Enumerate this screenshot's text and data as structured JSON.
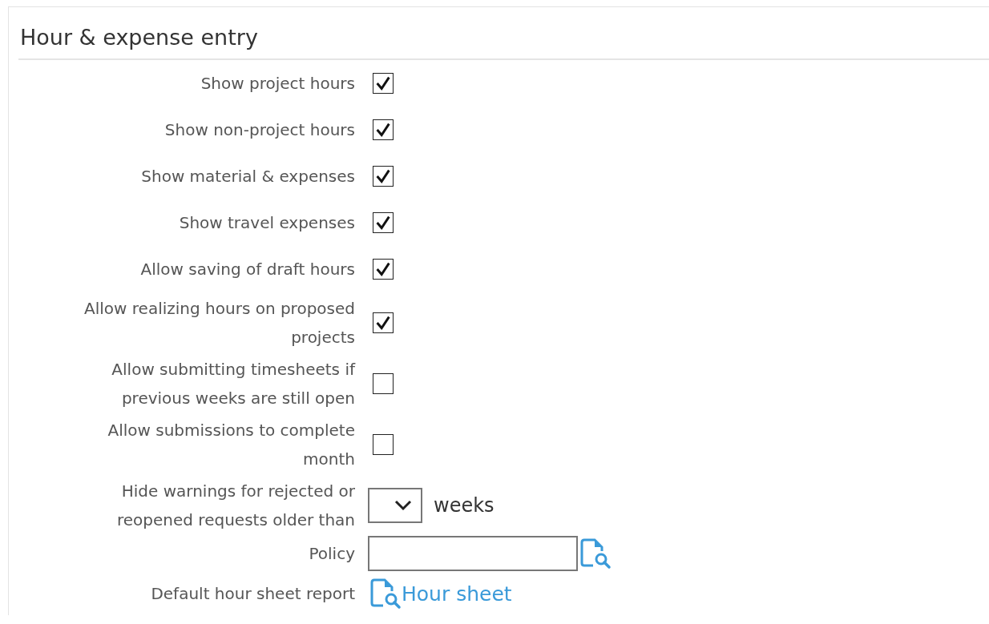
{
  "section": {
    "title": "Hour & expense entry"
  },
  "settings": [
    {
      "kind": "checkbox",
      "label": "Show project hours",
      "checked": true
    },
    {
      "kind": "checkbox",
      "label": "Show non-project hours",
      "checked": true
    },
    {
      "kind": "checkbox",
      "label": "Show material & expenses",
      "checked": true
    },
    {
      "kind": "checkbox",
      "label": "Show travel expenses",
      "checked": true
    },
    {
      "kind": "checkbox",
      "label": "Allow saving of draft hours",
      "checked": true
    },
    {
      "kind": "checkbox",
      "label": "Allow realizing hours on proposed projects",
      "checked": true
    },
    {
      "kind": "checkbox",
      "label": "Allow submitting timesheets if previous weeks are still open",
      "checked": false
    },
    {
      "kind": "checkbox",
      "label": "Allow submissions to complete month",
      "checked": false
    },
    {
      "kind": "select",
      "label": "Hide warnings for rejected or reopened requests older than",
      "unit": "weeks"
    },
    {
      "kind": "lookup",
      "label": "Policy"
    },
    {
      "kind": "link",
      "label": "Default hour sheet report",
      "link_text": "Hour sheet"
    }
  ]
}
